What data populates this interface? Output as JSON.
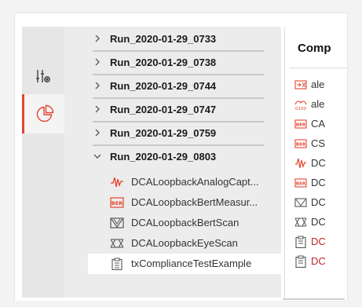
{
  "tree": {
    "runs": [
      {
        "label": "Run_2020-01-29_0733",
        "expanded": false
      },
      {
        "label": "Run_2020-01-29_0738",
        "expanded": false
      },
      {
        "label": "Run_2020-01-29_0744",
        "expanded": false
      },
      {
        "label": "Run_2020-01-29_0747",
        "expanded": false
      },
      {
        "label": "Run_2020-01-29_0759",
        "expanded": false
      },
      {
        "label": "Run_2020-01-29_0803",
        "expanded": true
      }
    ],
    "children": [
      {
        "label": "DCALoopbackAnalogCapt...",
        "icon": "analog-waveform-icon"
      },
      {
        "label": "DCALoopbackBertMeasur...",
        "icon": "ber-icon"
      },
      {
        "label": "DCALoopbackBertScan",
        "icon": "bert-scan-icon"
      },
      {
        "label": "DCALoopbackEyeScan",
        "icon": "eye-scan-icon"
      },
      {
        "label": "txComplianceTestExample",
        "icon": "clipboard-icon",
        "selected": true
      }
    ]
  },
  "right_panel": {
    "heading": "Comp",
    "items": [
      {
        "label": "ale",
        "icon": "transform-icon"
      },
      {
        "label": "ale",
        "icon": "binary-wave-icon"
      },
      {
        "label": "CA",
        "icon": "ber-icon"
      },
      {
        "label": "CS",
        "icon": "ber-icon"
      },
      {
        "label": "DC",
        "icon": "analog-waveform-icon"
      },
      {
        "label": "DC",
        "icon": "ber-icon"
      },
      {
        "label": "DC",
        "icon": "bert-scan-icon"
      },
      {
        "label": "DC",
        "icon": "eye-scan-icon"
      },
      {
        "label": "DC",
        "icon": "clipboard-icon",
        "red": true
      },
      {
        "label": "DC",
        "icon": "clipboard-icon",
        "red": true
      }
    ]
  },
  "colors": {
    "accent": "#e5442f",
    "error_text": "#c0262a"
  }
}
